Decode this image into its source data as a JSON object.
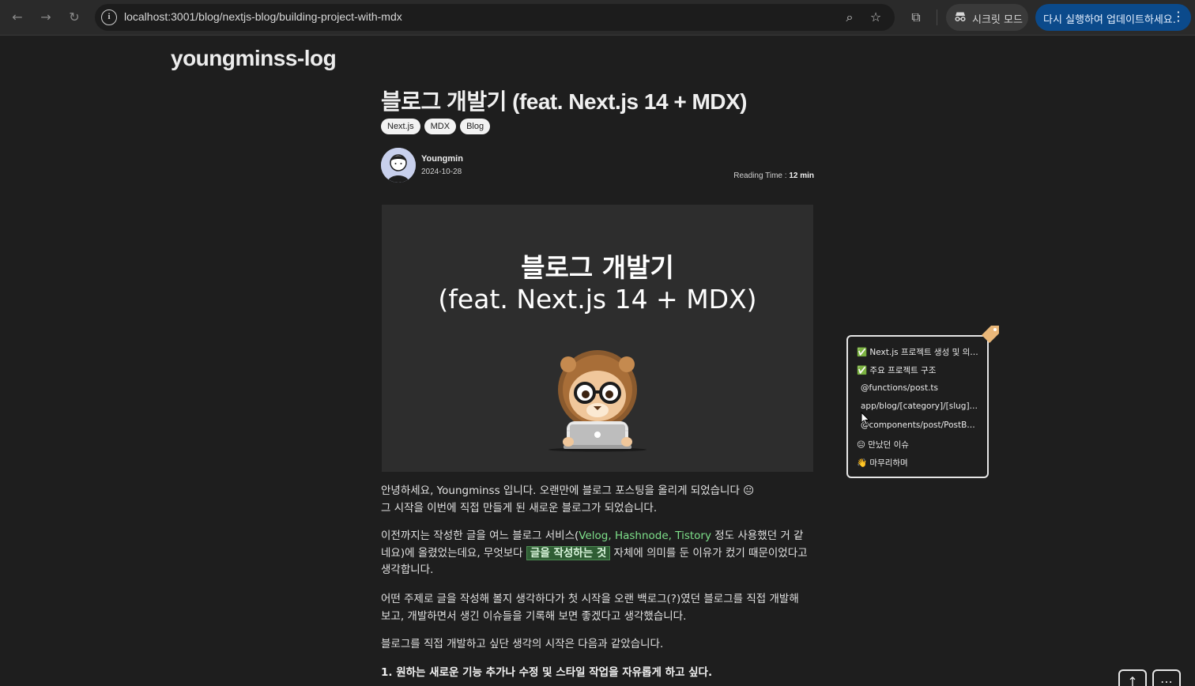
{
  "browser": {
    "url": "localhost:3001/blog/nextjs-blog/building-project-with-mdx",
    "incognito_label": "시크릿 모드",
    "update_label": "다시 실행하여 업데이트하세요.",
    "icons": {
      "back": "←",
      "forward": "→",
      "reload": "↻",
      "info": "i",
      "zoom": "⌕",
      "bookmark": "☆",
      "extensions": "⧉",
      "menu": "⋮"
    }
  },
  "site": {
    "title": "youngminss-log"
  },
  "post": {
    "title": "블로그 개발기 (feat. Next.js 14 + MDX)",
    "tags": [
      "Next.js",
      "MDX",
      "Blog"
    ],
    "author": "Youngmin",
    "date": "2024-10-28",
    "reading_label": "Reading Time : ",
    "reading_value": "12 min",
    "cover": {
      "line1": "블로그 개발기",
      "line2": "(feat. Next.js 14 + MDX)"
    },
    "paragraph1": {
      "line1": "안녕하세요, Youngminss 입니다. 오랜만에 블로그 포스팅을 올리게 되었습니다 😐",
      "line2": "그 시작을 이번에 직접 만들게 된 새로운 블로그가 되었습니다."
    },
    "paragraph2": {
      "pre": "이전까지는 작성한 글을 여느 블로그 서비스(",
      "services": "Velog, Hashnode, Tistory",
      "mid": " 정도 사용했던 거 같네요)에 올렸었는데요, 무엇보다 ",
      "highlight": "글을 작성하는 것",
      "post": " 자체에 의미를 둔 이유가 컸기 때문이었다고 생각합니다."
    },
    "paragraph3": "어떤 주제로 글을 작성해 볼지 생각하다가 첫 시작을 오랜 백로그(?)였던 블로그를 직접 개발해 보고, 개발하면서 생긴 이슈들을 기록해 보면 좋겠다고 생각했습니다.",
    "paragraph4": "블로그를 직접 개발하고 싶단 생각의 시작은 다음과 같았습니다.",
    "list_item1": "1. 원하는 새로운 기능 추가나 수정 및 스타일 작업을 자유롭게 하고 싶다."
  },
  "toc": {
    "items": [
      "✅ Next.js 프로젝트 생성 및 의존...",
      "✅ 주요 프로젝트 구조",
      "@functions/post.ts",
      "app/blog/[category]/[slug]/...",
      "@components/post/PostBo...",
      "😐 만났던 이슈",
      "👋 마무리하며"
    ]
  },
  "fab": {
    "top_icon": "↑",
    "menu_icon": "⋯"
  }
}
